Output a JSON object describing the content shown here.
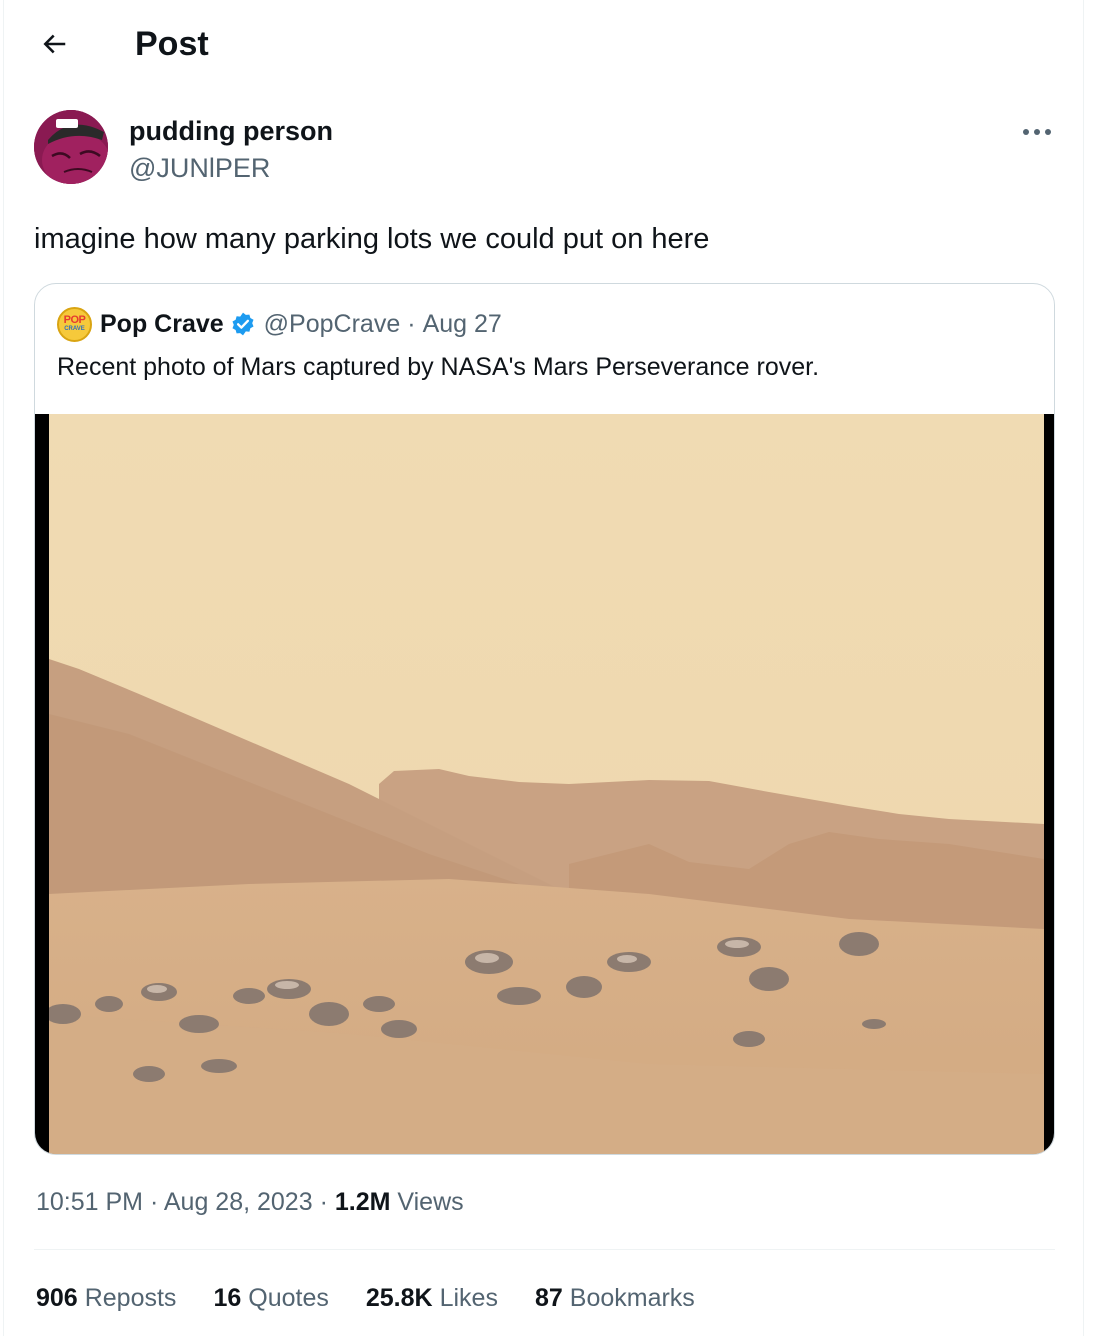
{
  "header": {
    "title": "Post"
  },
  "post": {
    "author_name": "pudding person",
    "author_handle": "@JUNlPER",
    "text": "imagine how many parking lots we could put on here",
    "time": "10:51 PM",
    "date": "Aug 28, 2023",
    "views_count": "1.2M",
    "views_label": "Views",
    "separator": "·"
  },
  "quote": {
    "avatar_text_top": "POP",
    "avatar_text_bottom": "CRAVE",
    "author_name": "Pop Crave",
    "author_handle": "@PopCrave",
    "date": "Aug 27",
    "separator": "·",
    "text": "Recent photo of Mars captured by NASA's Mars Perseverance rover."
  },
  "stats": [
    {
      "count": "906",
      "label": "Reposts"
    },
    {
      "count": "16",
      "label": "Quotes"
    },
    {
      "count": "25.8K",
      "label": "Likes"
    },
    {
      "count": "87",
      "label": "Bookmarks"
    }
  ],
  "colors": {
    "text_primary": "#0f1419",
    "text_secondary": "#536471",
    "verified": "#1d9bf0",
    "border": "#cfd9de"
  },
  "icons": [
    "back-arrow-icon",
    "more-options-icon",
    "verified-badge-icon"
  ]
}
